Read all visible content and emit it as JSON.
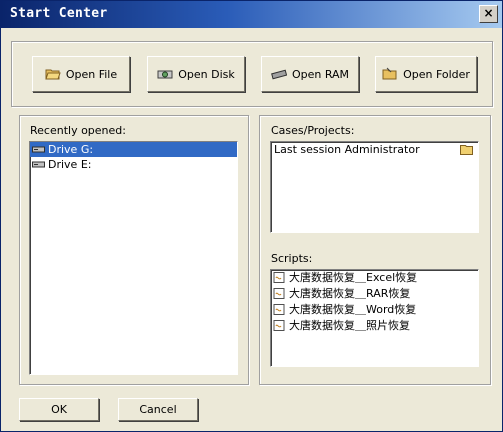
{
  "window": {
    "title": "Start Center",
    "close_glyph": "×"
  },
  "toolbar": {
    "open_file": "Open File",
    "open_disk": "Open Disk",
    "open_ram": "Open RAM",
    "open_folder": "Open Folder"
  },
  "recent": {
    "label": "Recently opened:",
    "items": [
      {
        "label": "Drive G:",
        "icon": "drive-icon",
        "selected": true
      },
      {
        "label": "Drive E:",
        "icon": "drive-icon",
        "selected": false
      }
    ]
  },
  "cases": {
    "label": "Cases/Projects:",
    "items": [
      {
        "label": "Last session Administrator",
        "icon": "folder-icon"
      }
    ]
  },
  "scripts": {
    "label": "Scripts:",
    "items": [
      {
        "label": "大唐数据恢复＿Excel恢复",
        "icon": "script-icon"
      },
      {
        "label": "大唐数据恢复＿RAR恢复",
        "icon": "script-icon"
      },
      {
        "label": "大唐数据恢复＿Word恢复",
        "icon": "script-icon"
      },
      {
        "label": "大唐数据恢复＿照片恢复",
        "icon": "script-icon"
      }
    ]
  },
  "footer": {
    "ok": "OK",
    "cancel": "Cancel"
  },
  "colors": {
    "title_bar": "#0a246a",
    "selection": "#316ac5",
    "dialog_bg": "#ece9d8"
  }
}
